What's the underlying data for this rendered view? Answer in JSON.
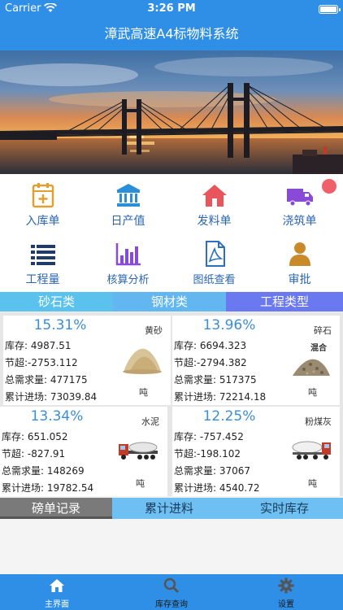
{
  "status": {
    "carrier": "Carrier",
    "time": "3:26 PM"
  },
  "title": "漳武高速A4标物料系统",
  "menu": {
    "items": [
      {
        "label": "入库单",
        "icon": "clipboard-plus-icon"
      },
      {
        "label": "日产值",
        "icon": "bank-icon"
      },
      {
        "label": "发料单",
        "icon": "house-icon"
      },
      {
        "label": "浇筑单",
        "icon": "truck-icon"
      },
      {
        "label": "工程量",
        "icon": "list-icon"
      },
      {
        "label": "核算分析",
        "icon": "bar-chart-icon"
      },
      {
        "label": "图纸查看",
        "icon": "pdf-document-icon"
      },
      {
        "label": "审批",
        "icon": "user-icon"
      }
    ]
  },
  "category_tabs": [
    {
      "label": "砂石类",
      "color": "#5bc2ee"
    },
    {
      "label": "钢材类",
      "color": "#62b7f0"
    },
    {
      "label": "工程类型",
      "color": "#6a79ef"
    }
  ],
  "materials": [
    {
      "percent": "15.31%",
      "name": "黄砂",
      "sub": "",
      "stock_label": "库存:",
      "stock": "4987.51",
      "over_label": "节超:",
      "over": "-2753.112",
      "demand_label": "总需求量:",
      "demand": "477175",
      "cumulative_label": "累计进场:",
      "cumulative": "73039.84",
      "unit": "吨"
    },
    {
      "percent": "13.96%",
      "name": "碎石",
      "sub": "混合",
      "stock_label": "库存:",
      "stock": "6694.323",
      "over_label": "节超:",
      "over": "-2794.382",
      "demand_label": "总需求量:",
      "demand": "517375",
      "cumulative_label": "累计进场:",
      "cumulative": "72214.18",
      "unit": "吨"
    },
    {
      "percent": "13.34%",
      "name": "水泥",
      "sub": "",
      "stock_label": "库存:",
      "stock": "651.052",
      "over_label": "节超:",
      "over": "-827.91",
      "demand_label": "总需求量:",
      "demand": "148269",
      "cumulative_label": "累计进场:",
      "cumulative": "19782.54",
      "unit": "吨"
    },
    {
      "percent": "12.25%",
      "name": "粉煤灰",
      "sub": "",
      "stock_label": "库存:",
      "stock": "-757.452",
      "over_label": "节超:",
      "over": "-198.102",
      "demand_label": "总需求量:",
      "demand": "37067",
      "cumulative_label": "累计进场:",
      "cumulative": "4540.72",
      "unit": "吨"
    }
  ],
  "record_tabs": [
    {
      "label": "磅单记录",
      "active": true
    },
    {
      "label": "累计进料",
      "active": false
    },
    {
      "label": "实时库存",
      "active": false
    }
  ],
  "tabbar": [
    {
      "label": "主界面",
      "icon": "home-icon"
    },
    {
      "label": "库存查询",
      "icon": "search-icon"
    },
    {
      "label": "设置",
      "icon": "gear-icon"
    }
  ],
  "colors": {
    "primary": "#2f8fe6",
    "menu_text": "#2a66b3",
    "percent": "#3a8ed8"
  }
}
